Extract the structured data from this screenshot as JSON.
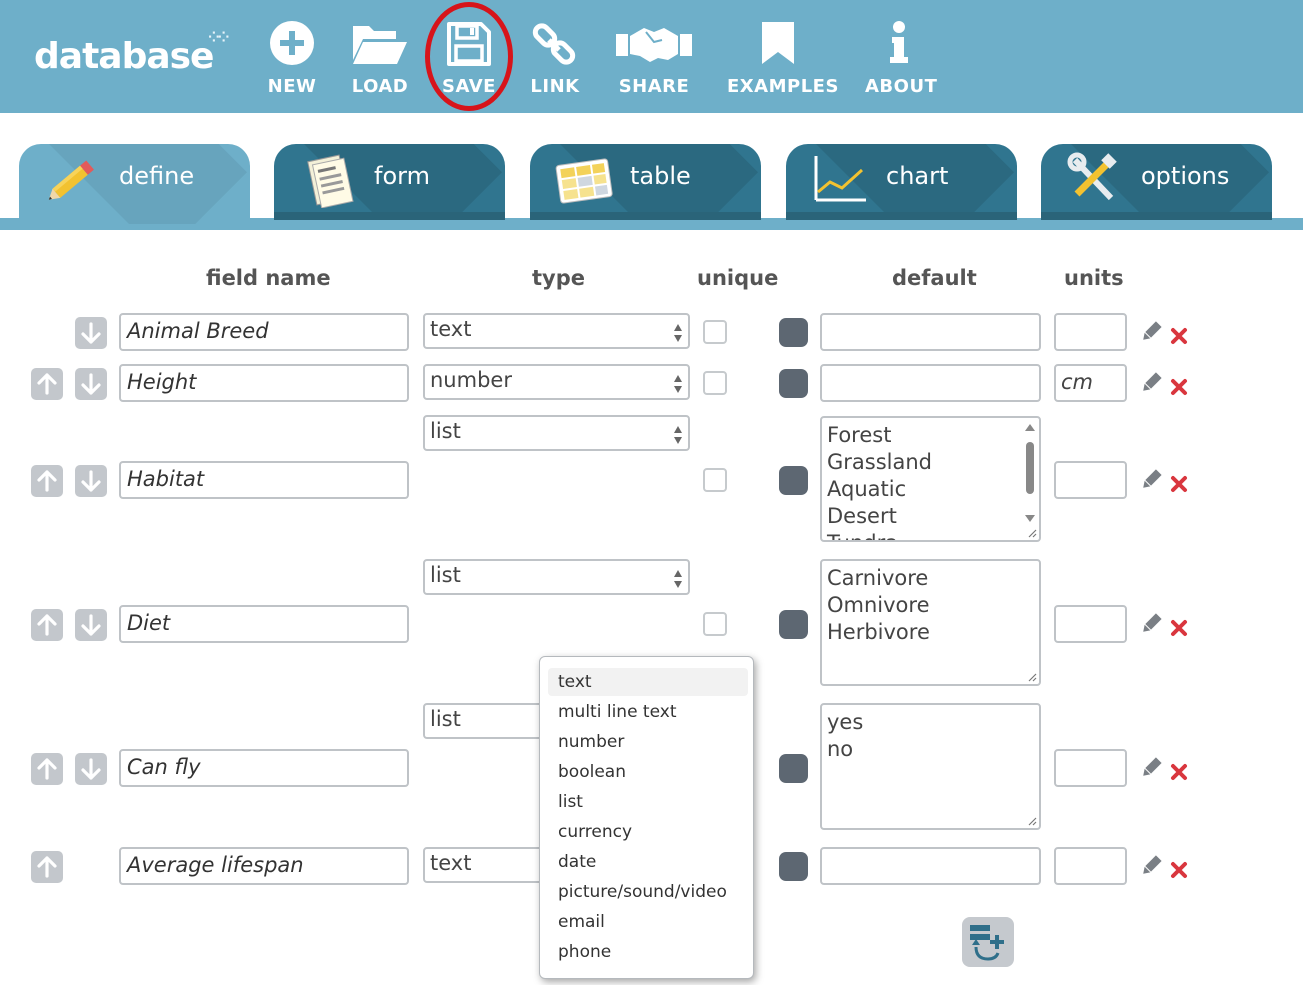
{
  "app": {
    "logo": "database"
  },
  "toolbar": {
    "new": "NEW",
    "load": "LOAD",
    "save": "SAVE",
    "link": "LINK",
    "share": "SHARE",
    "examples": "EXAMPLES",
    "about": "ABOUT"
  },
  "tabs": {
    "define": "define",
    "form": "form",
    "table": "table",
    "chart": "chart",
    "options": "options"
  },
  "columns": {
    "field_name": "field name",
    "type": "type",
    "unique": "unique",
    "default": "default",
    "units": "units"
  },
  "rows": [
    {
      "field_name": "Animal Breed",
      "type": "text",
      "units": ""
    },
    {
      "field_name": "Height",
      "type": "number",
      "units": "cm"
    },
    {
      "field_name": "Habitat",
      "type": "list",
      "list_values": [
        "Forest",
        "Grassland",
        "Aquatic",
        "Desert",
        "Tundra"
      ],
      "units": ""
    },
    {
      "field_name": "Diet",
      "type": "list",
      "list_values": [
        "Carnivore",
        "Omnivore",
        "Herbivore"
      ],
      "units": ""
    },
    {
      "field_name": "Can fly",
      "type": "list",
      "list_values": [
        "yes",
        "no"
      ],
      "units": ""
    },
    {
      "field_name": "Average lifespan",
      "type": "text",
      "units": ""
    }
  ],
  "type_dropdown": {
    "options": [
      "text",
      "multi line text",
      "number",
      "boolean",
      "list",
      "currency",
      "date",
      "picture/sound/video",
      "email",
      "phone"
    ],
    "highlighted": "text"
  },
  "colors": {
    "header_bg": "#6eafc9",
    "tab_bg": "#30758f",
    "save_highlight": "#d7141a",
    "delete_red": "#d9363e"
  }
}
